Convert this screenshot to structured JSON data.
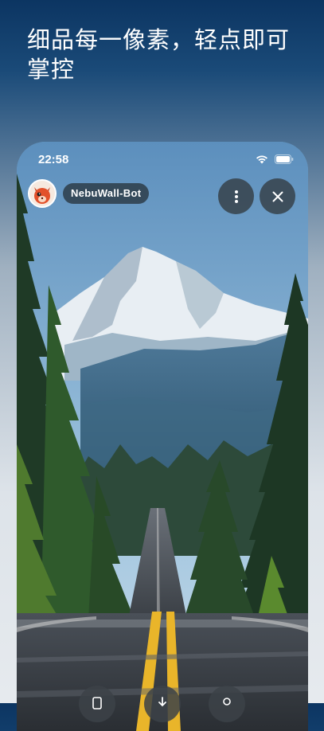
{
  "headline": "细品每一像素，轻点即可掌控",
  "status_bar": {
    "time": "22:58",
    "icons": [
      "wifi-icon",
      "battery-icon"
    ]
  },
  "bot": {
    "name": "NebuWall-Bot",
    "avatar_icon": "red-fox-avatar",
    "avatar_color": "#e2502a"
  },
  "top_actions": [
    {
      "icon": "more-vertical-icon"
    },
    {
      "icon": "close-icon"
    }
  ],
  "bottom_actions": [
    {
      "icon": "phone-icon"
    },
    {
      "icon": "download-icon"
    },
    {
      "icon": "profile-icon"
    }
  ],
  "colors": {
    "background_top": "#0c3562",
    "background_bottom": "#e6eaee",
    "button_fill": "#343e46",
    "road_line": "#e9b52a"
  },
  "wallpaper": "Snow-capped mountain at the end of a straight road lined with pine forests"
}
